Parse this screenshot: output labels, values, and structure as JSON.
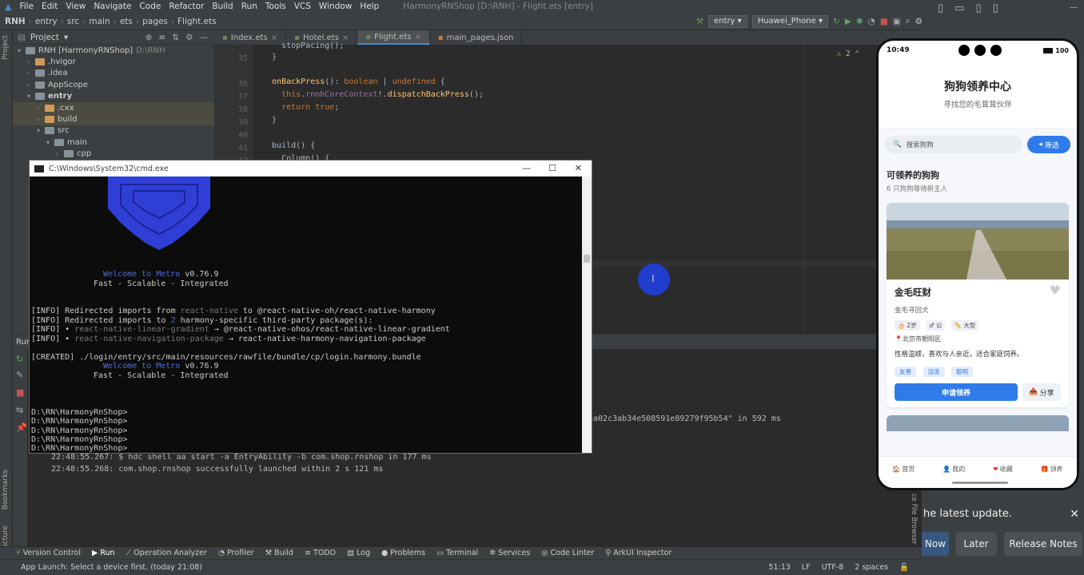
{
  "menu": {
    "items": [
      "File",
      "Edit",
      "View",
      "Navigate",
      "Code",
      "Refactor",
      "Build",
      "Run",
      "Tools",
      "VCS",
      "Window",
      "Help"
    ],
    "window_title": "HarmonyRNShop [D:\\RNH] - Flight.ets [entry]"
  },
  "nav": {
    "crumbs": [
      "RNH",
      "entry",
      "src",
      "main",
      "ets",
      "pages",
      "Flight.ets"
    ],
    "module": "entry",
    "device": "Huawei_Phone"
  },
  "project": {
    "header": "Project",
    "rows": [
      {
        "text": "RNH [HarmonyRNShop]",
        "extra": "D:\\RNH",
        "indent": 0,
        "open": true
      },
      {
        "text": ".hvigor",
        "indent": 1,
        "open": false,
        "color": "orange"
      },
      {
        "text": ".idea",
        "indent": 1,
        "open": false
      },
      {
        "text": "AppScope",
        "indent": 1,
        "open": false
      },
      {
        "text": "entry",
        "indent": 1,
        "open": true,
        "bold": true
      },
      {
        "text": ".cxx",
        "indent": 2,
        "open": false,
        "color": "orange",
        "sel": true
      },
      {
        "text": "build",
        "indent": 2,
        "open": false,
        "color": "orange",
        "sel": true
      },
      {
        "text": "src",
        "indent": 2,
        "open": true
      },
      {
        "text": "main",
        "indent": 3,
        "open": true
      },
      {
        "text": "cpp",
        "indent": 4,
        "open": false
      }
    ]
  },
  "tabs": [
    "Index.ets",
    "Hotel.ets",
    "Flight.ets",
    "main_pages.json"
  ],
  "editor": {
    "line_numbers": [
      "35",
      "36",
      "37",
      "38",
      "39",
      "40",
      "41",
      "42"
    ],
    "warn": "2",
    "lines": [
      {
        "t": "    stopPacing();"
      },
      {
        "t": "  }"
      },
      {
        "t": ""
      },
      {
        "t": "  onBackPress(): boolean | undefined {"
      },
      {
        "t": "    this.rnohCoreContext!.dispatchBackPress();"
      },
      {
        "t": "    return true;"
      },
      {
        "t": "  }"
      },
      {
        "t": ""
      },
      {
        "t": "  build() {"
      },
      {
        "t": "    Column() {"
      }
    ]
  },
  "run": {
    "tab": "Run:",
    "lines": [
      "aa02c3ab34e508591e89279f95b54\" in 592 ms",
      "22:48:55.267: $ hdc shell aa start -a EntryAbility -b com.shop.rnshop in 177 ms",
      "22:48:55.268: com.shop.rnshop successfully launched within 2 s 121 ms"
    ]
  },
  "cmd": {
    "title": "C:\\Windows\\System32\\cmd.exe",
    "welcome_a": "Welcome to Metro",
    "version": "v0.76.9",
    "tagline": "Fast - Scalable - Integrated",
    "info1a": "[INFO] Redirected imports from ",
    "info1b": "react-native",
    "info1c": " to @react-native-oh/react-native-harmony",
    "info2a": "[INFO] Redirected imports to ",
    "info2b": "2",
    "info2c": " harmony-specific third-party package(s):",
    "info3a": "[INFO] • ",
    "info3b": "react-native-linear-gradient",
    "info3c": " → @react-native-ohos/react-native-linear-gradient",
    "info4a": "[INFO] • ",
    "info4b": "react-native-navigation-package",
    "info4c": " → react-native-harmony-navigation-package",
    "created": "[CREATED] ./login/entry/src/main/resources/rawfile/bundle/cp/login.harmony.bundle",
    "prompt": "D:\\RN\\HarmonyRnShop>"
  },
  "toolwindows": [
    "Version Control",
    "Run",
    "Operation Analyzer",
    "Profiler",
    "Build",
    "TODO",
    "Log",
    "Problems",
    "Terminal",
    "Services",
    "Code Linter",
    "ArkUI Inspector"
  ],
  "status": {
    "left": "App Launch: Select a device first. (today 21:08)",
    "pos": "51:13",
    "sep": "LF",
    "enc": "UTF-8",
    "indent": "2 spaces"
  },
  "phone": {
    "time": "10:49",
    "battery": "100",
    "title": "狗狗领养中心",
    "subtitle": "寻找您的毛茸茸伙伴",
    "search_placeholder": "搜索狗狗",
    "filter": "筛选",
    "section_title": "可领养的狗狗",
    "section_sub": "6 只狗狗等待新主人",
    "dog": {
      "name": "金毛旺财",
      "breed": "金毛寻回犬",
      "age": "2岁",
      "gender": "公",
      "size": "大型",
      "location": "北京市朝阳区",
      "desc": "性格温顺，喜欢与人亲近，适合家庭饲养。",
      "tags": [
        "友善",
        "活泼",
        "聪明"
      ],
      "apply": "申请领养",
      "share": "分享"
    },
    "nav": [
      "首页",
      "我的",
      "收藏",
      "领养"
    ]
  },
  "notification": {
    "text": "he latest update.",
    "btn_now": "Now",
    "btn_later": "Later",
    "btn_notes": "Release Notes"
  },
  "colors": {
    "accent": "#2f7bea",
    "ide_bg": "#2b2b2b",
    "panel": "#3c3f41"
  }
}
